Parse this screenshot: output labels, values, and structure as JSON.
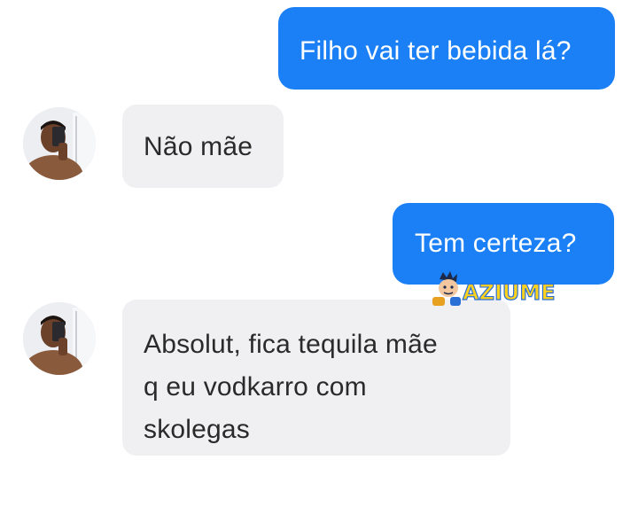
{
  "messages": [
    {
      "direction": "sent",
      "text": "Filho vai ter bebida lá?"
    },
    {
      "direction": "received",
      "text": "Não mãe"
    },
    {
      "direction": "sent",
      "text": "Tem certeza?"
    },
    {
      "direction": "received",
      "lines": [
        "Absolut, fica tequila mãe",
        "q eu vodkarro com",
        "skolegas"
      ]
    }
  ],
  "watermark": {
    "text": "AZIUME"
  },
  "colors": {
    "sent_bubble": "#1b80f5",
    "received_bubble": "#f0f0f2",
    "sent_text": "#ffffff",
    "received_text": "#2a2a2a"
  },
  "icons": {
    "avatar": "profile-photo-avatar-icon",
    "watermark_mascot": "mascot-face-icon"
  }
}
